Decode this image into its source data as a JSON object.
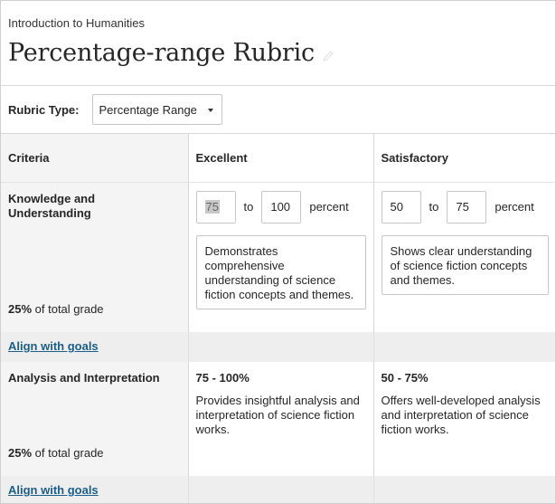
{
  "header": {
    "course": "Introduction to Humanities",
    "title": "Percentage-range Rubric"
  },
  "rubric_type": {
    "label": "Rubric Type:",
    "selected": "Percentage Range"
  },
  "columns": [
    "Criteria",
    "Excellent",
    "Satisfactory"
  ],
  "criteria": [
    {
      "name": "Knowledge and Understanding",
      "grade_pct": "25%",
      "grade_suffix": " of total grade",
      "align_label": "Align with goals",
      "levels": [
        {
          "from": "75",
          "to_label": "to",
          "to": "100",
          "unit": "percent",
          "description": "Demonstrates comprehensive understanding of science fiction concepts and themes."
        },
        {
          "from": "50",
          "to_label": "to",
          "to": "75",
          "unit": "percent",
          "description": "Shows clear understanding of science fiction concepts and themes."
        }
      ]
    },
    {
      "name": "Analysis and Interpretation",
      "grade_pct": "25%",
      "grade_suffix": " of total grade",
      "align_label": "Align with goals",
      "levels": [
        {
          "range": "75 - 100%",
          "description": "Provides insightful analysis and interpretation of science fiction works."
        },
        {
          "range": "50 - 75%",
          "description": "Offers well-developed analysis and interpretation of science fiction works."
        }
      ]
    }
  ],
  "colors": {
    "link": "#1b5e88",
    "criteria_bg": "#f4f4f4",
    "align_bg": "#eeeeee",
    "border": "#c7c7c7"
  }
}
